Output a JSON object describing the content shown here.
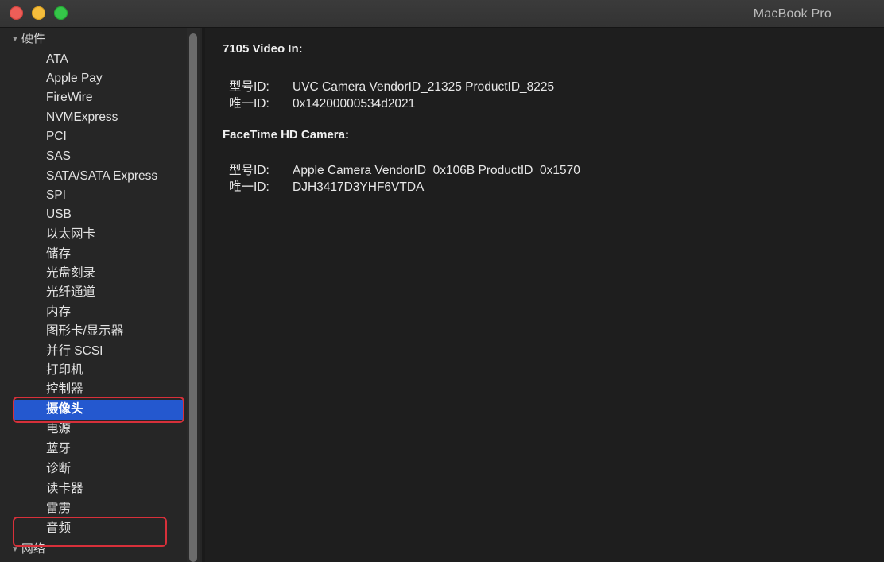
{
  "window": {
    "title": "MacBook Pro"
  },
  "sidebar": {
    "group_hardware": "硬件",
    "items": [
      "ATA",
      "Apple Pay",
      "FireWire",
      "NVMExpress",
      "PCI",
      "SAS",
      "SATA/SATA Express",
      "SPI",
      "USB",
      "以太网卡",
      "储存",
      "光盘刻录",
      "光纤通道",
      "内存",
      "图形卡/显示器",
      "并行 SCSI",
      "打印机",
      "控制器",
      "摄像头",
      "电源",
      "蓝牙",
      "诊断",
      "读卡器",
      "雷雳",
      "音频"
    ],
    "selected_item": "摄像头",
    "group_network": "网络"
  },
  "content": {
    "sections": [
      {
        "title": "7105 Video In:",
        "rows": [
          {
            "key": "型号ID:",
            "value": "UVC Camera VendorID_21325 ProductID_8225"
          },
          {
            "key": "唯一ID:",
            "value": "0x14200000534d2021"
          }
        ]
      },
      {
        "title": "FaceTime HD Camera:",
        "rows": [
          {
            "key": "型号ID:",
            "value": "Apple Camera VendorID_0x106B ProductID_0x1570"
          },
          {
            "key": "唯一ID:",
            "value": "DJH3417D3YHF6VTDA"
          }
        ]
      }
    ]
  },
  "colors": {
    "selection": "#2458cf",
    "highlight_box": "#d7303a"
  }
}
